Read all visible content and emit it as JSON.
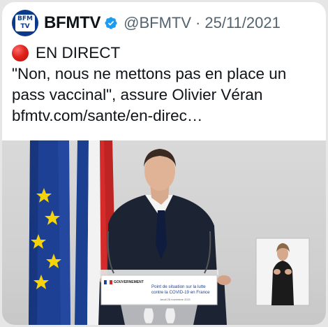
{
  "tweet": {
    "author_name": "BFMTV",
    "handle": "@BFMTV",
    "separator": "·",
    "date": "25/11/2021",
    "avatar_text": "BFM TV",
    "live_label": "EN DIRECT",
    "text_line1": "\"Non, nous ne mettons pas en place un",
    "text_line2": "pass vaccinal\", assure Olivier Véran",
    "link": "bfmtv.com/sante/en-direc…"
  },
  "media": {
    "podium_brand": "GOUVERNEMENT",
    "podium_line1": "Point de situation sur la lutte",
    "podium_line2": "contre la COVID-19 en France",
    "podium_line3": "Jeudi 25 novembre 2021"
  },
  "colors": {
    "verified_blue": "#1d9bf0",
    "text": "#0f1419",
    "muted": "#536471",
    "live_red": "#e0241b",
    "eu_blue": "#1d3f94",
    "flag_red": "#d52b2b"
  },
  "icons": {
    "verified": "verified-badge-icon",
    "live": "red-circle-icon"
  }
}
